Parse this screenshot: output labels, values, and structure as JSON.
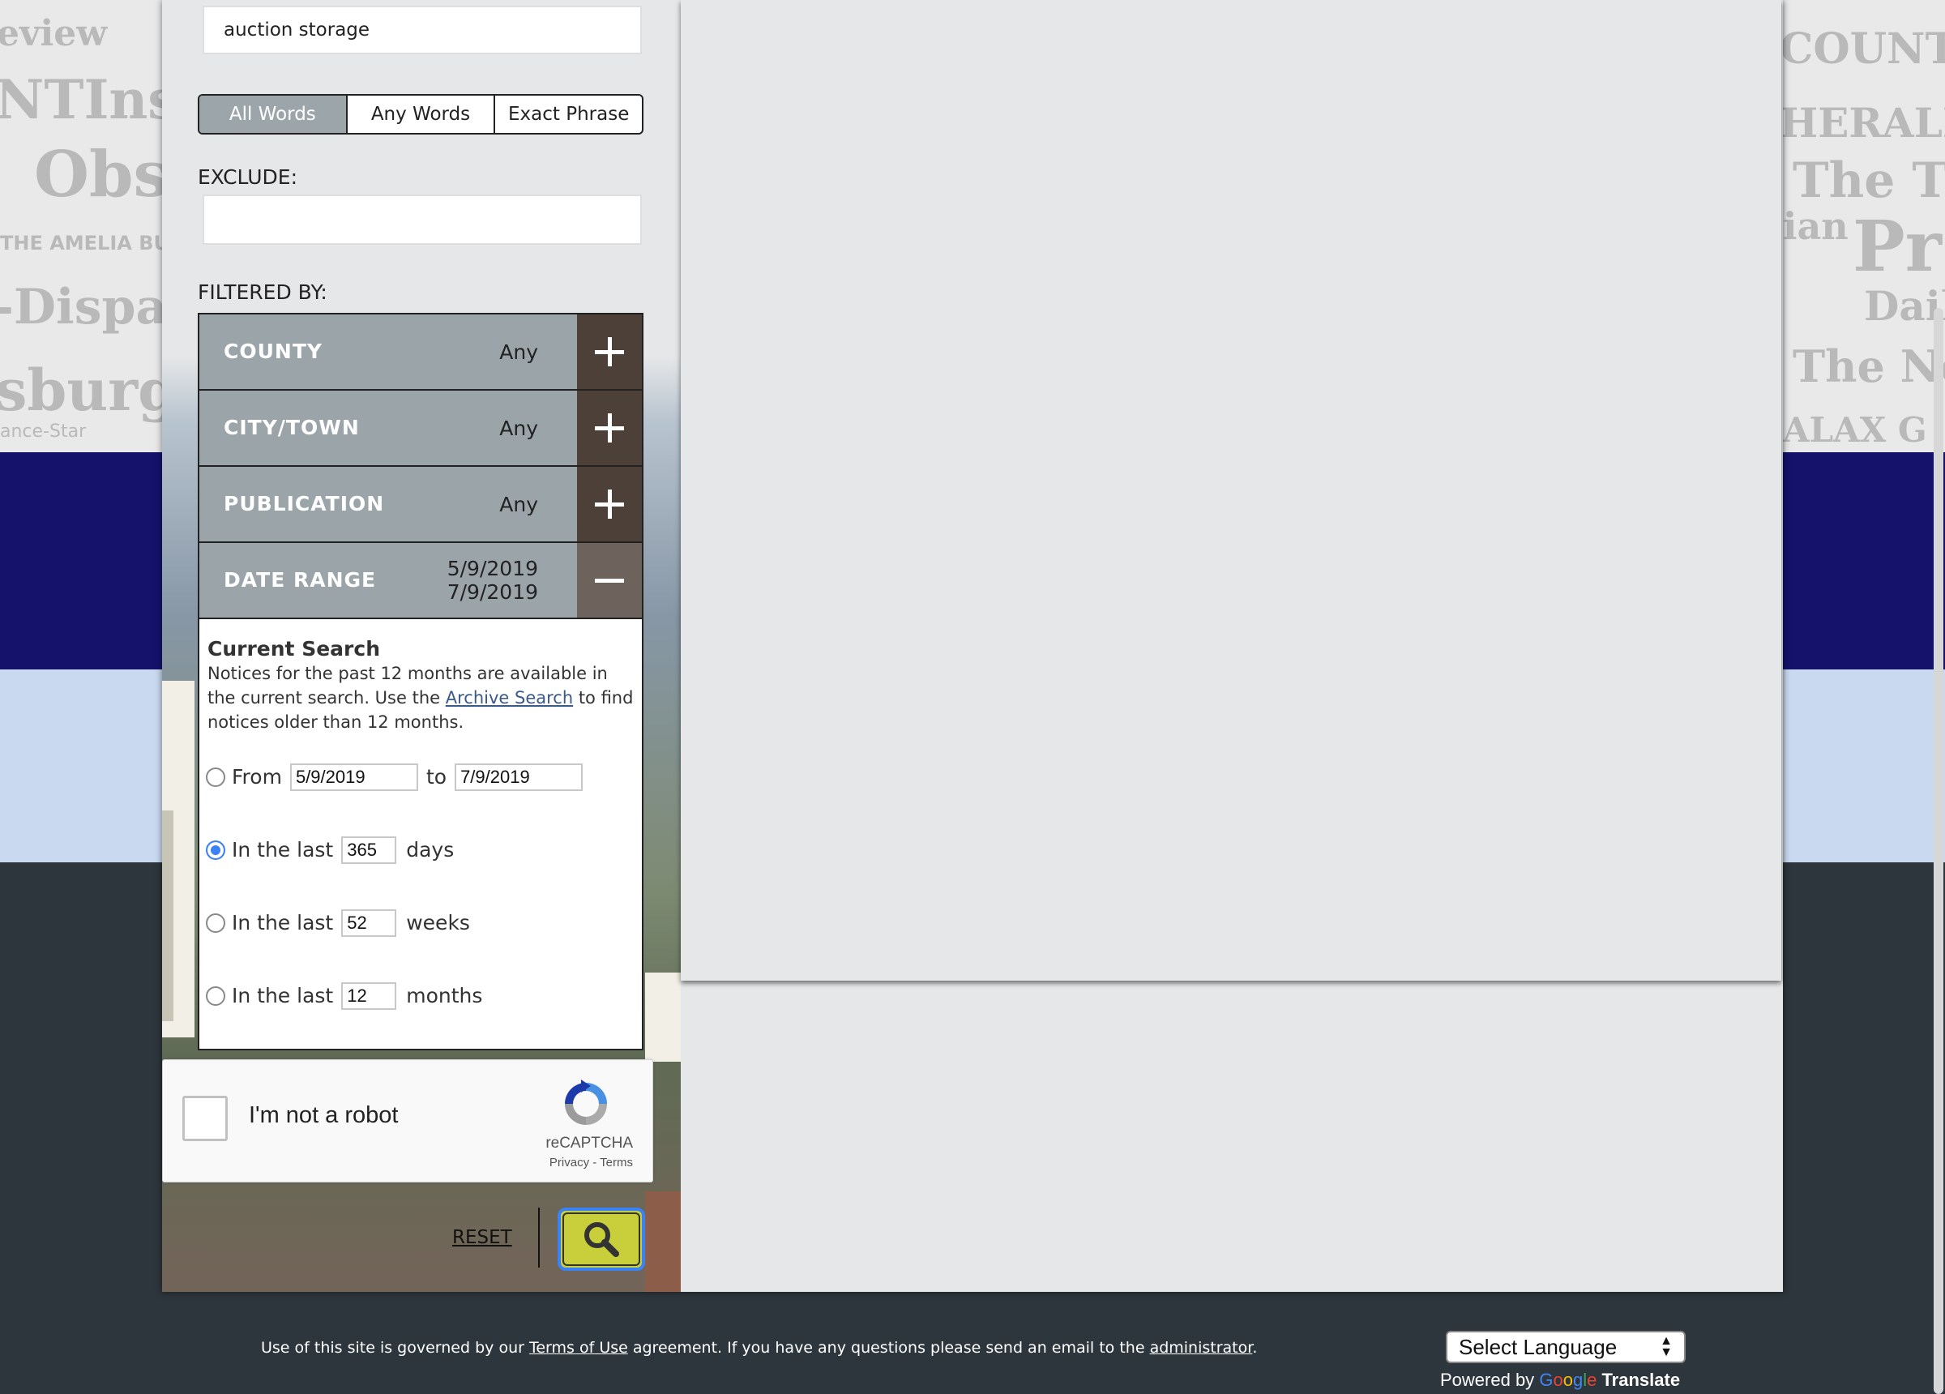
{
  "search": {
    "keywords_value": "auction storage",
    "match_modes": [
      "All Words",
      "Any Words",
      "Exact Phrase"
    ],
    "active_mode": "All Words",
    "exclude_label": "EXCLUDE:",
    "exclude_value": ""
  },
  "filters": {
    "title": "FILTERED BY:",
    "rows": [
      {
        "name": "COUNTY",
        "value": "Any"
      },
      {
        "name": "CITY/TOWN",
        "value": "Any"
      },
      {
        "name": "PUBLICATION",
        "value": "Any"
      },
      {
        "name": "DATE RANGE",
        "value_from": "5/9/2019",
        "value_to": "7/9/2019"
      }
    ]
  },
  "date_panel": {
    "heading": "Current Search",
    "desc_before": "Notices for the past 12 months are available in the current search. Use the ",
    "desc_link": "Archive Search",
    "desc_after": " to find notices older than 12 months.",
    "from_label": "From",
    "from_value": "5/9/2019",
    "to_label": "to",
    "to_value": "7/9/2019",
    "last_label": "In the last",
    "days_value": "365",
    "days_unit": "days",
    "weeks_value": "52",
    "weeks_unit": "weeks",
    "months_value": "12",
    "months_unit": "months",
    "selected_option": "days"
  },
  "captcha": {
    "label": "I'm not a robot",
    "brand": "reCAPTCHA",
    "links": "Privacy - Terms"
  },
  "actions": {
    "reset_label": "RESET"
  },
  "footer": {
    "text_before": "Use of this site is governed by our ",
    "terms_link": "Terms of Use",
    "text_middle": " agreement. If you have any questions please send an email to the ",
    "admin_link": "administrator",
    "text_after": ".",
    "language_select": "Select Language",
    "powered_by": "Powered by",
    "translate": "Translate"
  },
  "background_newspapers": [
    "eview",
    "NTInsi",
    "Obs",
    "THE AMELIA BULLETIN",
    "-Dispatc",
    "sburg",
    "ance-Star",
    "COUNTY R",
    "HERALI",
    "The Tid",
    "ian",
    "Pr",
    "Daily",
    "The New",
    "ALAX G"
  ],
  "colors": {
    "navy_band": "#14126b",
    "light_band": "#c9d9ef",
    "footer_bg": "#2d363c",
    "filter_row": "#9ba4a9",
    "toggle_bg": "#4c4038",
    "search_button": "#c9cf3a",
    "focus_ring": "#3b82f6"
  }
}
